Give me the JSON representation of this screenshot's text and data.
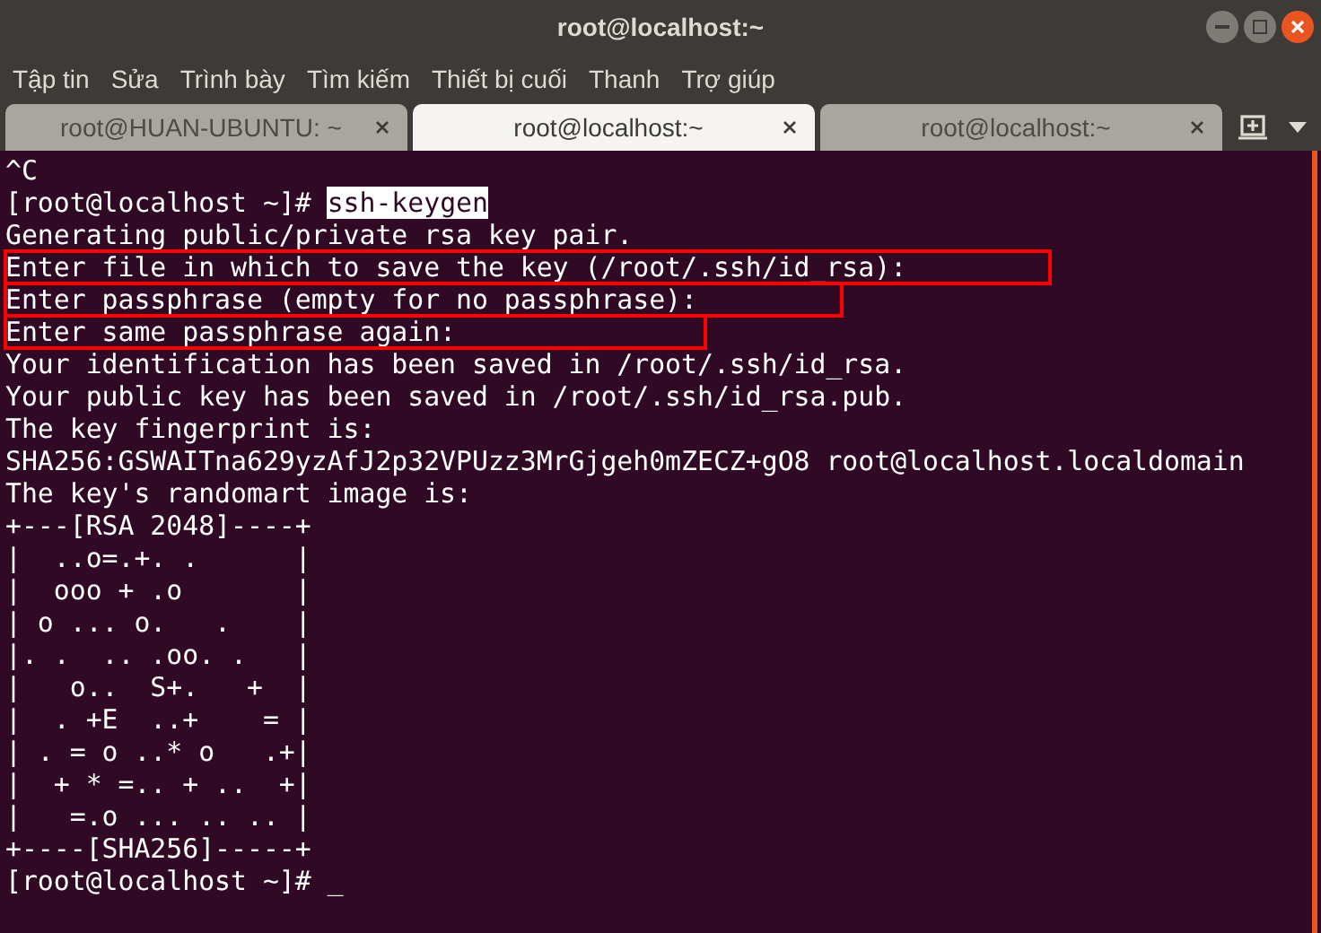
{
  "window": {
    "title": "root@localhost:~"
  },
  "menu": [
    "Tập tin",
    "Sửa",
    "Trình bày",
    "Tìm kiếm",
    "Thiết bị cuối",
    "Thanh",
    "Trợ giúp"
  ],
  "tabs": [
    {
      "label": "root@HUAN-UBUNTU: ~",
      "selected": false
    },
    {
      "label": "root@localhost:~",
      "selected": true
    },
    {
      "label": "root@localhost:~",
      "selected": false
    }
  ],
  "terminal": {
    "lines": [
      {
        "kind": "output",
        "text": "^C",
        "boxed": false
      },
      {
        "kind": "command",
        "prompt": "[root@localhost ~]# ",
        "command": "ssh-keygen",
        "selected": true
      },
      {
        "kind": "output",
        "text": "Generating public/private rsa key pair.",
        "boxed": false
      },
      {
        "kind": "output",
        "text": "Enter file in which to save the key (/root/.ssh/id_rsa):",
        "boxed": true
      },
      {
        "kind": "output",
        "text": "Enter passphrase (empty for no passphrase):",
        "boxed": true
      },
      {
        "kind": "output",
        "text": "Enter same passphrase again:",
        "boxed": true
      },
      {
        "kind": "output",
        "text": "Your identification has been saved in /root/.ssh/id_rsa.",
        "boxed": false
      },
      {
        "kind": "output",
        "text": "Your public key has been saved in /root/.ssh/id_rsa.pub.",
        "boxed": false
      },
      {
        "kind": "output",
        "text": "The key fingerprint is:",
        "boxed": false
      },
      {
        "kind": "output",
        "text": "SHA256:GSWAITna629yzAfJ2p32VPUzz3MrGjgeh0mZECZ+gO8 root@localhost.localdomain",
        "boxed": false
      },
      {
        "kind": "output",
        "text": "The key's randomart image is:",
        "boxed": false
      },
      {
        "kind": "output",
        "text": "+---[RSA 2048]----+",
        "boxed": false
      },
      {
        "kind": "output",
        "text": "|  ..o=.+. .      |",
        "boxed": false
      },
      {
        "kind": "output",
        "text": "|  ooo + .o       |",
        "boxed": false
      },
      {
        "kind": "output",
        "text": "| o ... o.   .    |",
        "boxed": false
      },
      {
        "kind": "output",
        "text": "|. .  .. .oo. .   |",
        "boxed": false
      },
      {
        "kind": "output",
        "text": "|   o..  S+.   +  |",
        "boxed": false
      },
      {
        "kind": "output",
        "text": "|  . +E  ..+    = |",
        "boxed": false
      },
      {
        "kind": "output",
        "text": "| . = o ..* o   .+|",
        "boxed": false
      },
      {
        "kind": "output",
        "text": "|  + * =.. + ..  +|",
        "boxed": false
      },
      {
        "kind": "output",
        "text": "|   =.o ... .. .. |",
        "boxed": false
      },
      {
        "kind": "output",
        "text": "+----[SHA256]-----+",
        "boxed": false
      },
      {
        "kind": "prompt",
        "prompt": "[root@localhost ~]# ",
        "cursor": "_"
      }
    ]
  }
}
